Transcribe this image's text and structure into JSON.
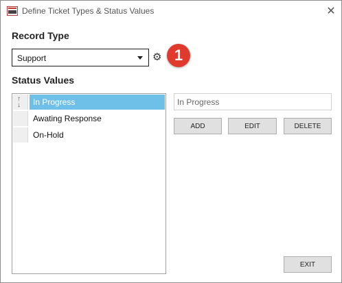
{
  "window": {
    "title": "Define Ticket Types & Status Values",
    "close_symbol": "✕",
    "app_icon": "lcm-app-icon"
  },
  "record_type": {
    "label": "Record Type",
    "selected": "Support",
    "settings_icon": "gear-icon",
    "badge": "1"
  },
  "status_values": {
    "label": "Status Values",
    "items": [
      {
        "label": "In Progress",
        "selected": true
      },
      {
        "label": "Awating Response",
        "selected": false
      },
      {
        "label": "On-Hold",
        "selected": false
      }
    ],
    "reorder_icon": "up-down-arrows-icon"
  },
  "editor": {
    "value": "In Progress",
    "add_label": "ADD",
    "edit_label": "EDIT",
    "delete_label": "DELETE"
  },
  "footer": {
    "exit_label": "EXIT"
  },
  "colors": {
    "selection": "#6ec0e9",
    "badge": "#e03a2e"
  }
}
